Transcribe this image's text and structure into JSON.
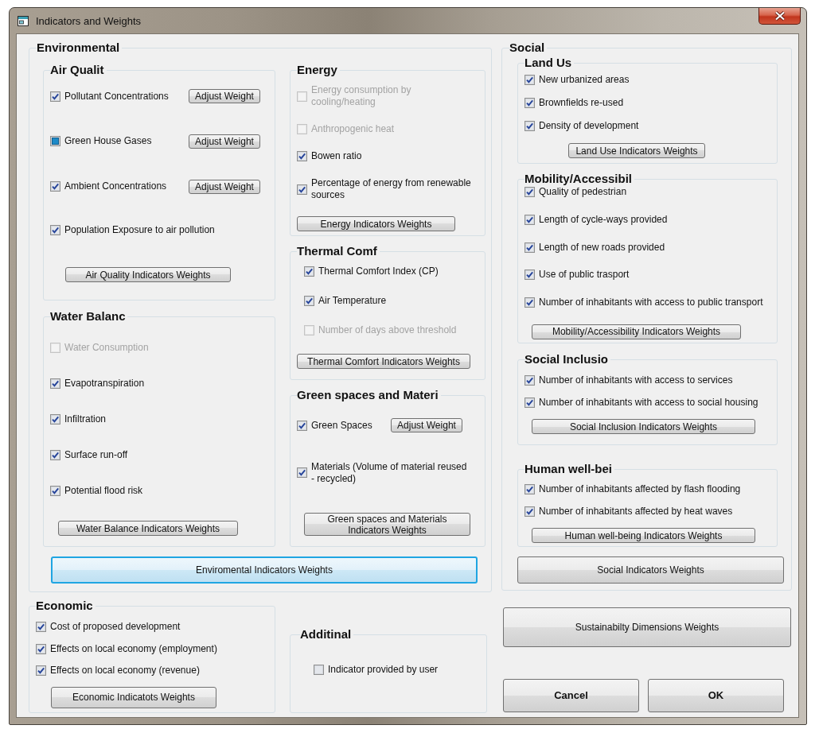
{
  "window": {
    "title": "Indicators and Weights"
  },
  "environmental": {
    "title": "Environmental",
    "columns": [
      {
        "groups": [
          {
            "title": "Air Qualit",
            "indicators": [
              {
                "label": "Pollutant Concentrations",
                "checked": true,
                "indeterminate": false,
                "adjust_button": "Adjust Weight"
              },
              {
                "label": "Green House Gases",
                "checked": false,
                "indeterminate": true,
                "adjust_button": "Adjust Weight"
              },
              {
                "label": "Ambient Concentrations",
                "checked": true,
                "indeterminate": false,
                "adjust_button": "Adjust Weight"
              },
              {
                "label": "Population Exposure to air pollution",
                "checked": true,
                "indeterminate": false
              }
            ],
            "button": "Air Quality Indicators Weights"
          },
          {
            "title": "Water Balanc",
            "indicators": [
              {
                "label": "Water Consumption",
                "checked": false,
                "disabled": true
              },
              {
                "label": "Evapotranspiration",
                "checked": true,
                "disabled": false
              },
              {
                "label": "Infiltration",
                "checked": true,
                "disabled": false
              },
              {
                "label": "Surface run-off",
                "checked": true,
                "disabled": false
              },
              {
                "label": "Potential flood risk",
                "checked": true,
                "disabled": false
              }
            ],
            "button": "Water Balance Indicators Weights"
          }
        ]
      },
      {
        "groups": [
          {
            "title": "Energy",
            "indicators": [
              {
                "label": "Energy consumption by cooling/heating",
                "checked": false,
                "disabled": true
              },
              {
                "label": "Anthropogenic heat",
                "checked": false,
                "disabled": true
              },
              {
                "label": "Bowen ratio",
                "checked": true,
                "disabled": false
              },
              {
                "label": "Percentage of energy from renewable sources",
                "checked": true,
                "disabled": false
              }
            ],
            "button": "Energy Indicators Weights"
          },
          {
            "title": "Thermal Comf",
            "indicators": [
              {
                "label": "Thermal Comfort Index (CP)",
                "checked": true,
                "disabled": false
              },
              {
                "label": "Air Temperature",
                "checked": true,
                "disabled": false
              },
              {
                "label": "Number of days above threshold",
                "checked": false,
                "disabled": true
              }
            ],
            "button": "Thermal Comfort Indicators Weights"
          },
          {
            "title": "Green spaces and Materi",
            "indicators": [
              {
                "label": "Green Spaces",
                "checked": true,
                "adjust_button": "Adjust Weight"
              },
              {
                "label": "Materials (Volume of material reused - recycled)",
                "checked": true
              }
            ],
            "button": "Green spaces and Materials Indicators Weights"
          }
        ]
      }
    ],
    "button": {
      "label": "Enviromental Indicators Weights",
      "focused": true
    }
  },
  "economic": {
    "title": "Economic",
    "indicators": [
      {
        "label": "Cost of proposed development",
        "checked": true
      },
      {
        "label": "Effects on local economy (employment)",
        "checked": true
      },
      {
        "label": "Effects on local economy (revenue)",
        "checked": true
      }
    ],
    "button": "Economic Indicatots Weights"
  },
  "additional": {
    "title": "Additinal",
    "indicators": [
      {
        "label": "Indicator provided by user",
        "checked": false
      }
    ]
  },
  "social": {
    "title": "Social",
    "groups": [
      {
        "title": "Land Us",
        "indicators": [
          {
            "label": "New urbanized areas",
            "checked": true
          },
          {
            "label": "Brownfields re-used",
            "checked": true
          },
          {
            "label": "Density of development",
            "checked": true
          }
        ],
        "button": "Land Use Indicators Weights"
      },
      {
        "title": "Mobility/Accessibil",
        "indicators": [
          {
            "label": "Quality of pedestrian",
            "checked": true
          },
          {
            "label": "Length of cycle-ways provided",
            "checked": true
          },
          {
            "label": "Length of new roads provided",
            "checked": true
          },
          {
            "label": "Use of public trasport",
            "checked": true
          },
          {
            "label": "Number of inhabitants with access to public transport",
            "checked": true
          }
        ],
        "button": "Mobility/Accessibility Indicators Weights"
      },
      {
        "title": "Social Inclusio",
        "indicators": [
          {
            "label": "Number of inhabitants with access to services",
            "checked": true
          },
          {
            "label": "Number of inhabitants with access to social housing",
            "checked": true
          }
        ],
        "button": "Social Inclusion Indicators Weights"
      },
      {
        "title": "Human well-bei",
        "indicators": [
          {
            "label": "Number of inhabitants affected by flash flooding",
            "checked": true
          },
          {
            "label": "Number of inhabitants affected by heat waves",
            "checked": true
          }
        ],
        "button": "Human well-being Indicators Weights"
      }
    ],
    "button": {
      "label": "Social Indicators Weights",
      "focused": false
    }
  },
  "sustainability_button": {
    "label": "Sustainabilty Dimensions Weights",
    "focused": false
  },
  "dialog_buttons": [
    "Cancel",
    "OK"
  ]
}
